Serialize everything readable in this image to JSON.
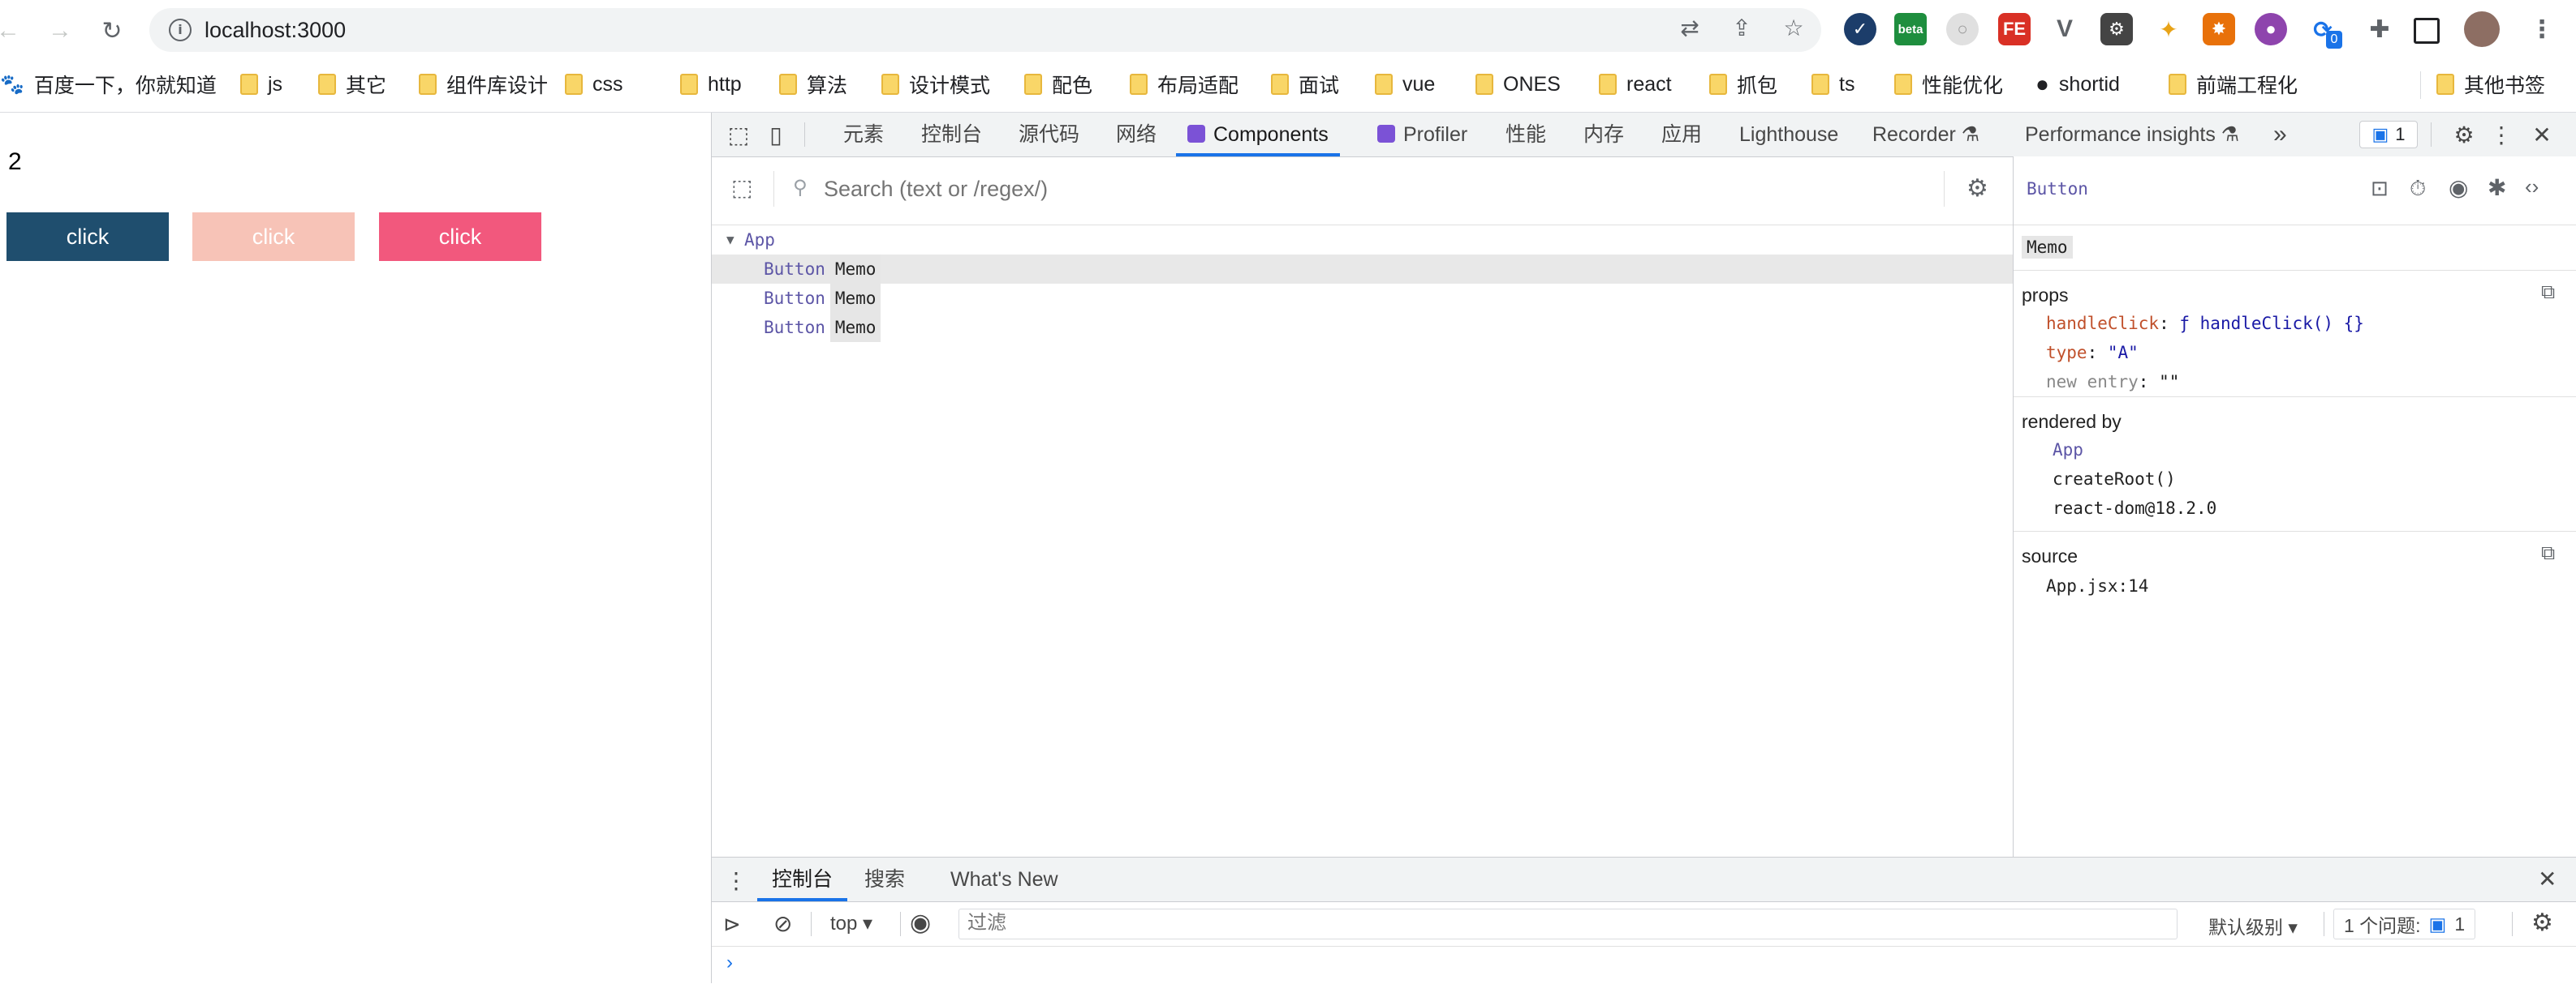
{
  "browser": {
    "url": "localhost:3000",
    "bookmarks": [
      {
        "label": "百度一下，你就知道",
        "kind": "site"
      },
      {
        "label": "js",
        "kind": "folder"
      },
      {
        "label": "其它",
        "kind": "folder"
      },
      {
        "label": "组件库设计",
        "kind": "folder"
      },
      {
        "label": "css",
        "kind": "folder"
      },
      {
        "label": "http",
        "kind": "folder"
      },
      {
        "label": "算法",
        "kind": "folder"
      },
      {
        "label": "设计模式",
        "kind": "folder"
      },
      {
        "label": "配色",
        "kind": "folder"
      },
      {
        "label": "布局适配",
        "kind": "folder"
      },
      {
        "label": "面试",
        "kind": "folder"
      },
      {
        "label": "vue",
        "kind": "folder"
      },
      {
        "label": "ONES",
        "kind": "folder"
      },
      {
        "label": "react",
        "kind": "folder"
      },
      {
        "label": "抓包",
        "kind": "folder"
      },
      {
        "label": "ts",
        "kind": "folder"
      },
      {
        "label": "性能优化",
        "kind": "folder"
      },
      {
        "label": "shortid",
        "kind": "site"
      },
      {
        "label": "前端工程化",
        "kind": "folder"
      },
      {
        "label": "其他书签",
        "kind": "folder"
      }
    ],
    "extensions": {
      "beta_label": "beta",
      "fe_label": "FE",
      "sync_badge": "0"
    }
  },
  "page": {
    "counter": "2",
    "buttons": [
      {
        "label": "click",
        "color": "#1f4e6e"
      },
      {
        "label": "click",
        "color": "#f7c3b7"
      },
      {
        "label": "click",
        "color": "#f2587d"
      }
    ]
  },
  "devtools": {
    "tabs": [
      "元素",
      "控制台",
      "源代码",
      "网络",
      "Components",
      "Profiler",
      "性能",
      "内存",
      "应用",
      "Lighthouse",
      "Recorder",
      "Performance insights"
    ],
    "active_tab": "Components",
    "issues_badge": "1",
    "search_placeholder": "Search (text or /regex/)",
    "tree": {
      "root": "App",
      "children": [
        {
          "name": "Button",
          "badge": "Memo"
        },
        {
          "name": "Button",
          "badge": "Memo"
        },
        {
          "name": "Button",
          "badge": "Memo"
        }
      ]
    },
    "selected": {
      "name": "Button",
      "badge": "Memo",
      "props_title": "props",
      "props": [
        {
          "key": "handleClick",
          "value": "ƒ handleClick() {}"
        },
        {
          "key": "type",
          "value": "\"A\""
        },
        {
          "key": "new entry",
          "value": "\"\""
        }
      ],
      "rendered_by_title": "rendered by",
      "rendered_by": [
        "App",
        "createRoot()",
        "react-dom@18.2.0"
      ],
      "source_title": "source",
      "source": "App.jsx:14"
    },
    "drawer": {
      "tabs": [
        "控制台",
        "搜索",
        "What's New"
      ],
      "context": "top",
      "filter_placeholder": "过滤",
      "level": "默认级别",
      "issues": "1 个问题:",
      "issues_count": "1"
    }
  }
}
